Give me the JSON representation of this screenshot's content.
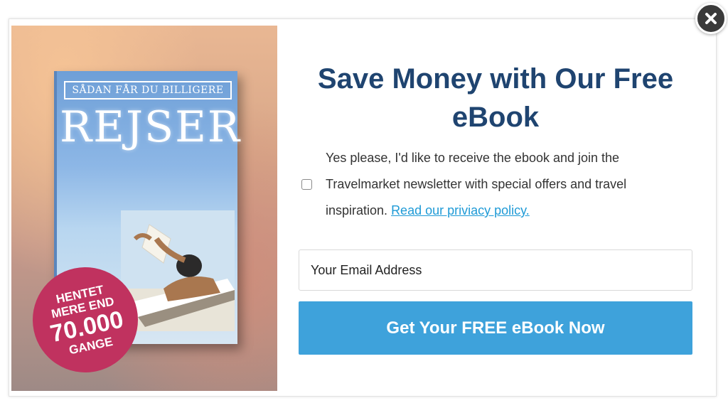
{
  "popup": {
    "headline": "Save Money with Our Free eBook",
    "consent_text": "Yes please, I'd like to receive the ebook and join the Travelmarket newsletter with special offers and travel inspiration.",
    "consent_link": "Read our priviacy policy.",
    "email_placeholder": "Your Email Address",
    "submit_label": "Get Your FREE eBook Now",
    "close_icon": "close-icon"
  },
  "book": {
    "subtitle": "SÅDAN FÅR DU BILLIGERE",
    "title": "REJSER"
  },
  "badge": {
    "line1": "HENTET",
    "line2": "MERE END",
    "number": "70.000",
    "line3": "GANGE"
  },
  "colors": {
    "headline": "#1f4470",
    "button": "#3ea2db",
    "link": "#1e9ad6",
    "badge": "#c0325f"
  }
}
